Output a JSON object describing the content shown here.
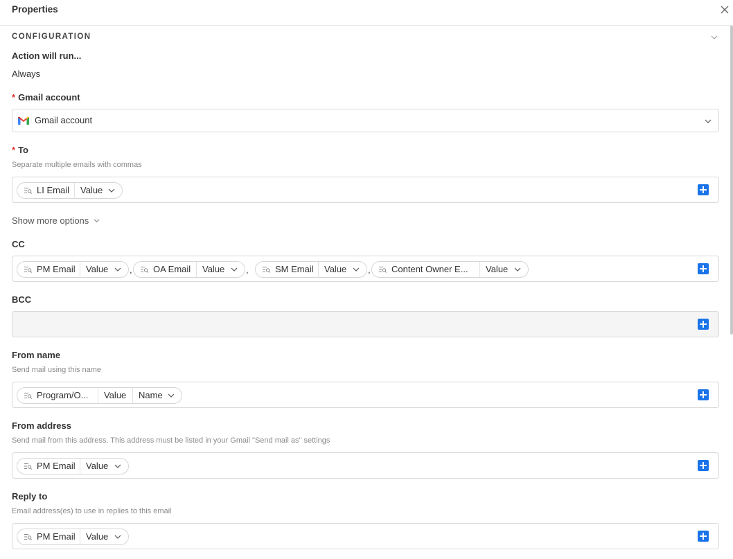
{
  "header": {
    "title": "Properties"
  },
  "section": {
    "title": "CONFIGURATION"
  },
  "run_condition": {
    "label": "Action will run...",
    "value": "Always"
  },
  "gmail_account": {
    "label": "Gmail account",
    "value": "Gmail account"
  },
  "to": {
    "label": "To",
    "help": "Separate multiple emails with commas",
    "pills": [
      {
        "name": "LI Email",
        "value": "Value"
      }
    ]
  },
  "show_more": "Show more options",
  "cc": {
    "label": "CC",
    "pills": [
      {
        "name": "PM Email",
        "value": "Value"
      },
      {
        "name": "OA Email",
        "value": "Value"
      },
      {
        "name": "SM Email",
        "value": "Value"
      },
      {
        "name": "Content Owner E...",
        "value": "Value"
      }
    ],
    "separator": ","
  },
  "bcc": {
    "label": "BCC"
  },
  "from_name": {
    "label": "From name",
    "help": "Send mail using this name",
    "pill": {
      "name": "Program/O...",
      "value": "Value",
      "sub": "Name"
    }
  },
  "from_address": {
    "label": "From address",
    "help": "Send mail from this address. This address must be listed in your Gmail \"Send mail as\" settings",
    "pill": {
      "name": "PM Email",
      "value": "Value"
    }
  },
  "reply_to": {
    "label": "Reply to",
    "help": "Email address(es) to use in replies to this email",
    "pill": {
      "name": "PM Email",
      "value": "Value"
    }
  },
  "colors": {
    "accent": "#1a73e8",
    "required": "#e0362e"
  }
}
